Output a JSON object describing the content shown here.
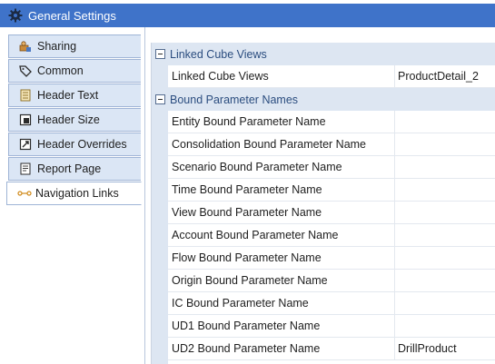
{
  "window": {
    "title": "General Settings",
    "icon": "gear-icon"
  },
  "nav": {
    "items": [
      {
        "label": "Sharing",
        "icon": "sharing-icon"
      },
      {
        "label": "Common",
        "icon": "tag-icon"
      },
      {
        "label": "Header Text",
        "icon": "document-text-icon"
      },
      {
        "label": "Header Size",
        "icon": "resize-icon"
      },
      {
        "label": "Header Overrides",
        "icon": "override-icon"
      },
      {
        "label": "Report Page",
        "icon": "report-page-icon"
      },
      {
        "label": "Navigation Links",
        "icon": "link-icon",
        "active": true
      }
    ]
  },
  "grid": {
    "categories": [
      {
        "label": "Linked Cube Views",
        "properties": [
          {
            "name": "Linked Cube Views",
            "value": "ProductDetail_2"
          }
        ]
      },
      {
        "label": "Bound Parameter Names",
        "properties": [
          {
            "name": "Entity Bound Parameter Name",
            "value": ""
          },
          {
            "name": "Consolidation Bound Parameter Name",
            "value": ""
          },
          {
            "name": "Scenario Bound Parameter Name",
            "value": ""
          },
          {
            "name": "Time Bound Parameter Name",
            "value": ""
          },
          {
            "name": "View Bound Parameter Name",
            "value": ""
          },
          {
            "name": "Account Bound Parameter Name",
            "value": ""
          },
          {
            "name": "Flow Bound Parameter Name",
            "value": ""
          },
          {
            "name": "Origin Bound Parameter Name",
            "value": ""
          },
          {
            "name": "IC Bound Parameter Name",
            "value": ""
          },
          {
            "name": "UD1 Bound Parameter Name",
            "value": ""
          },
          {
            "name": "UD2 Bound Parameter Name",
            "value": "DrillProduct"
          }
        ]
      }
    ]
  },
  "colors": {
    "title_bar": "#3f73c9",
    "nav_item_bg": "#dbe6f5",
    "category_bg": "#dde6f2"
  }
}
